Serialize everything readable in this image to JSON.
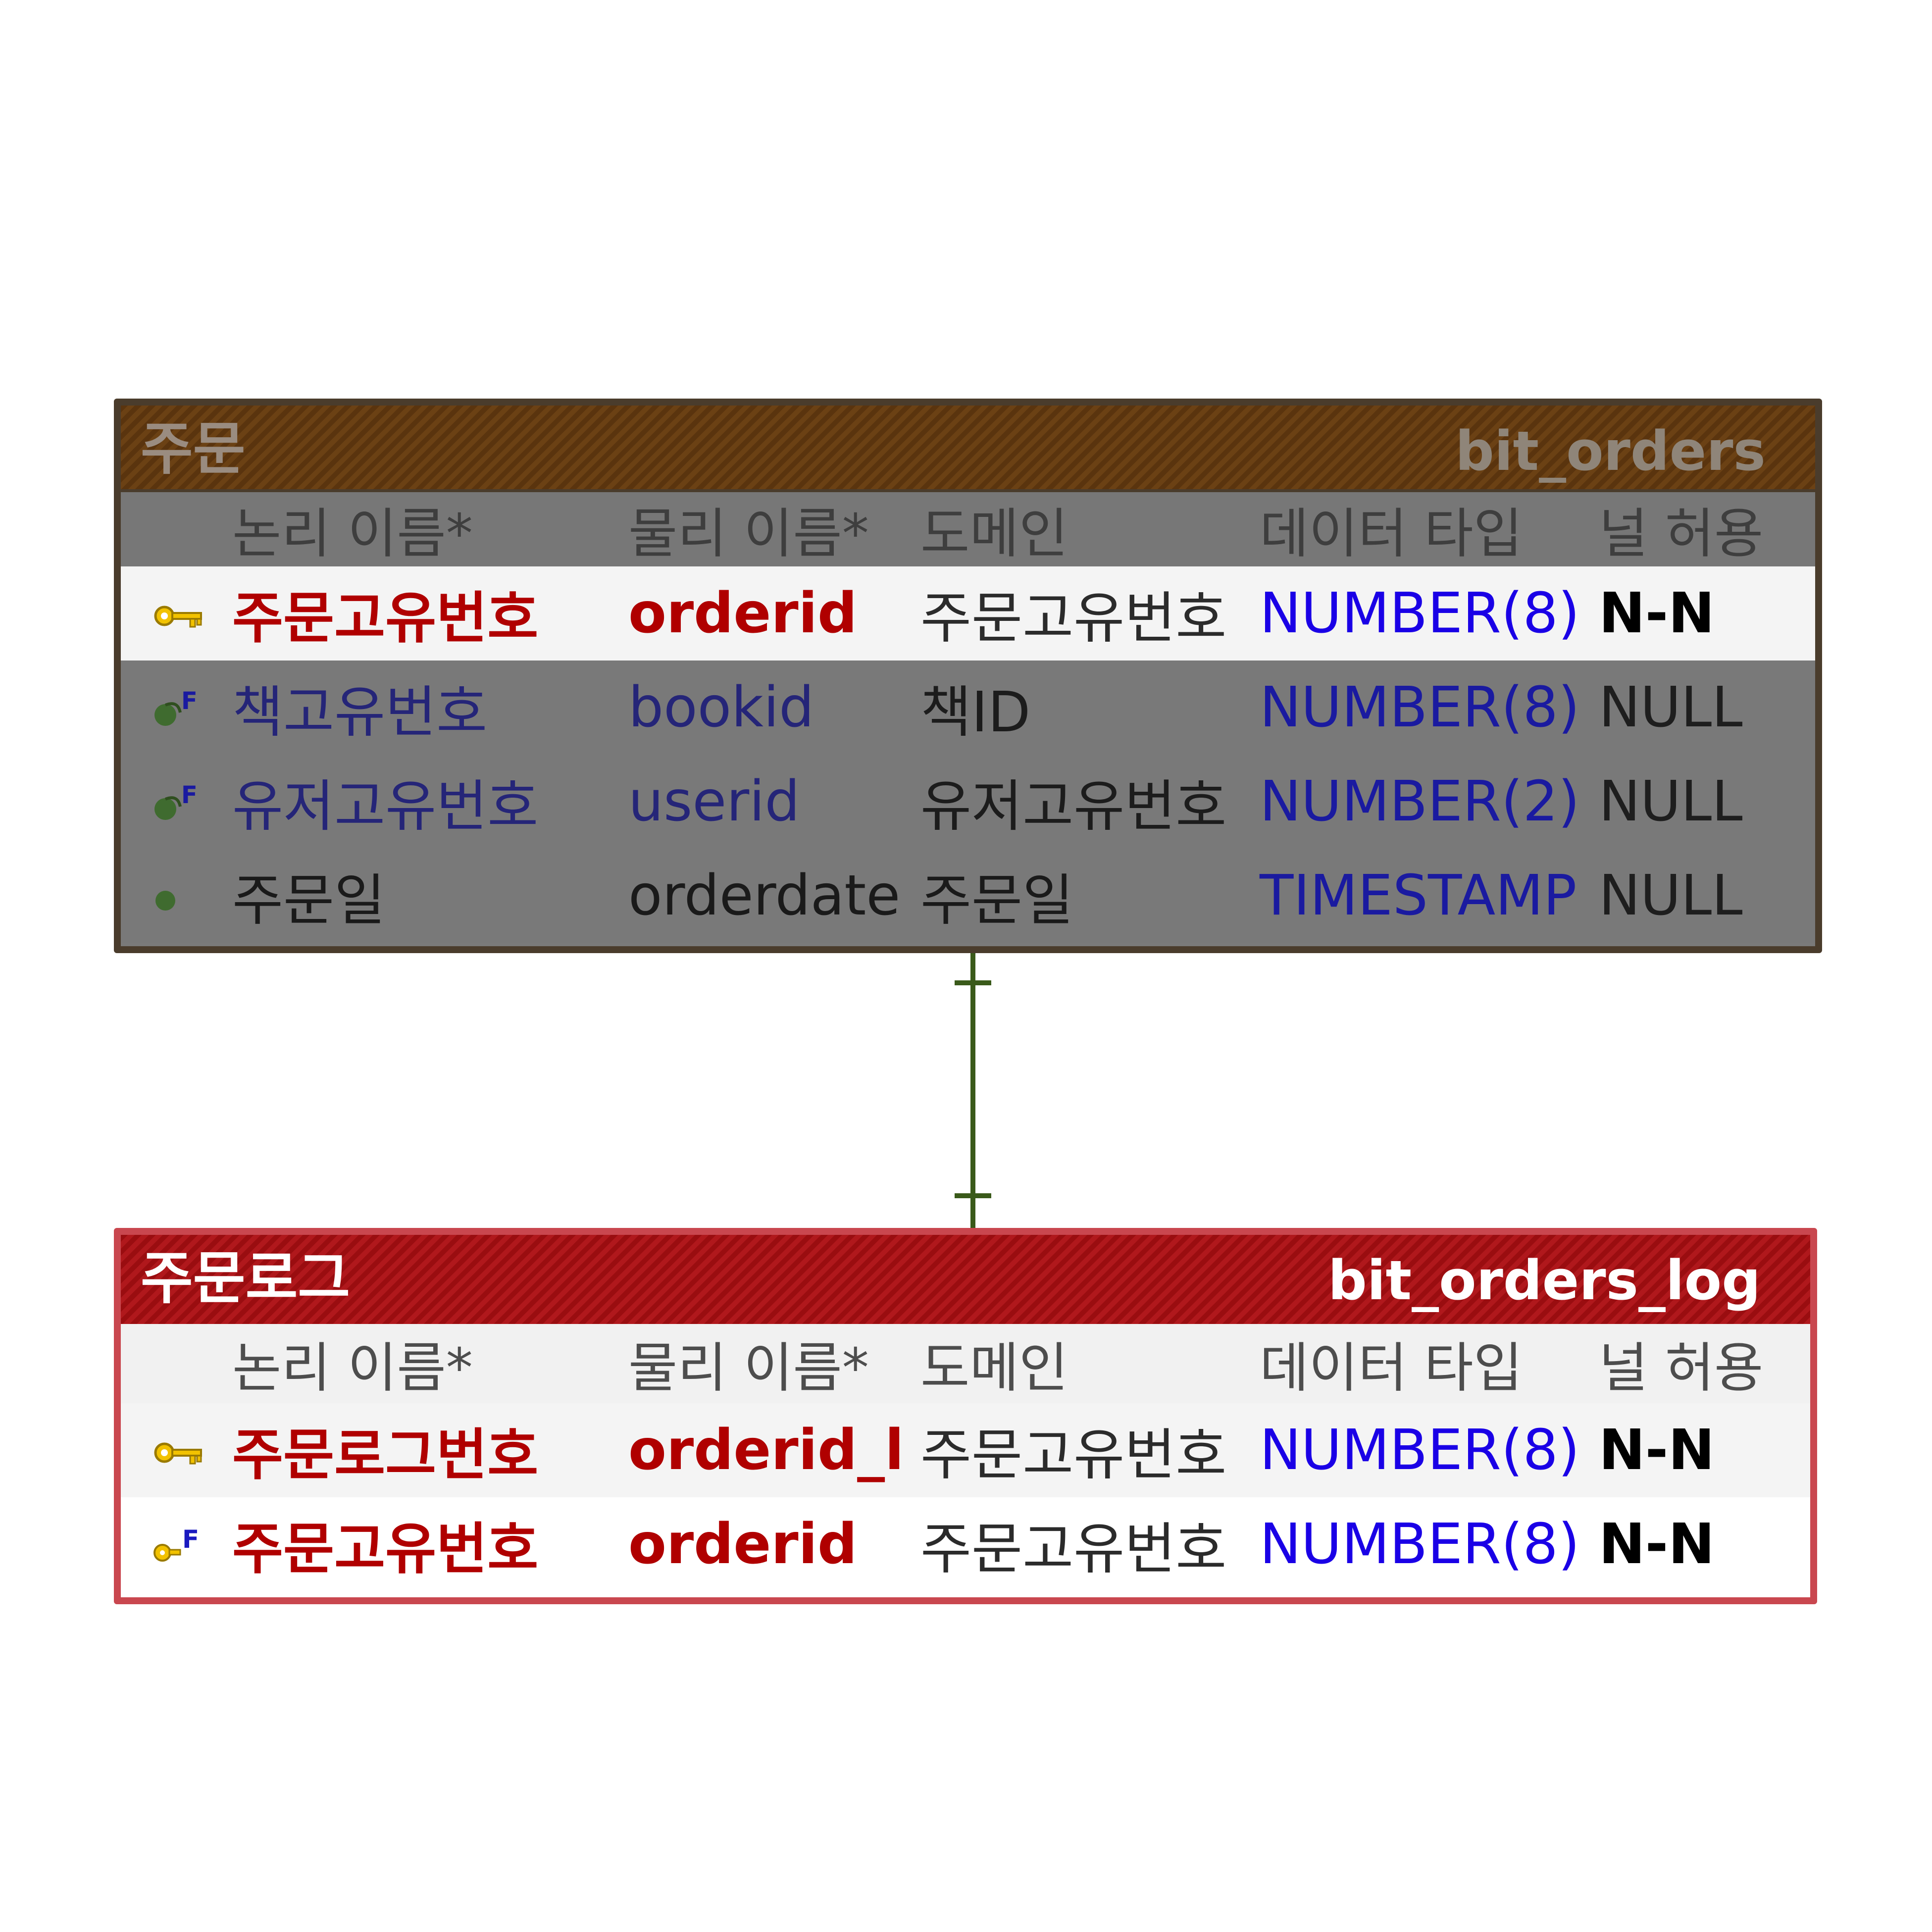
{
  "orders": {
    "logical_name": "주문",
    "physical_name": "bit_orders",
    "headers": {
      "logical": "논리 이름*",
      "physical": "물리 이름*",
      "domain": "도메인",
      "type": "데이터 타입",
      "null": "널 허용"
    },
    "rows": [
      {
        "key": "PK",
        "icon": "primary-key-icon",
        "logical": "주문고유번호",
        "physical": "orderid",
        "domain": "주문고유번호",
        "type": "NUMBER(8)",
        "null": "N-N"
      },
      {
        "key": "FK",
        "icon": "foreign-key-icon",
        "logical": "책고유번호",
        "physical": "bookid",
        "domain": "책ID",
        "type": "NUMBER(8)",
        "null": "NULL"
      },
      {
        "key": "FK",
        "icon": "foreign-key-icon",
        "logical": "유저고유번호",
        "physical": "userid",
        "domain": "유저고유번호",
        "type": "NUMBER(2)",
        "null": "NULL"
      },
      {
        "key": "",
        "icon": "attribute-icon",
        "logical": "주문일",
        "physical": "orderdate",
        "domain": "주문일",
        "type": "TIMESTAMP",
        "null": "NULL"
      }
    ]
  },
  "orders_log": {
    "logical_name": "주문로그",
    "physical_name": "bit_orders_log",
    "headers": {
      "logical": "논리 이름*",
      "physical": "물리 이름*",
      "domain": "도메인",
      "type": "데이터 타입",
      "null": "널 허용"
    },
    "rows": [
      {
        "key": "PK",
        "icon": "primary-key-icon",
        "logical": "주문로그번호",
        "physical": "orderid_l",
        "domain": "주문고유번호",
        "type": "NUMBER(8)",
        "null": "N-N"
      },
      {
        "key": "PFK",
        "icon": "primary-foreign-key-icon",
        "logical": "주문고유번호",
        "physical": "orderid",
        "domain": "주문고유번호",
        "type": "NUMBER(8)",
        "null": "N-N"
      }
    ]
  },
  "colors": {
    "orders_header": "#5a340e",
    "orders_log_header": "#9a0d10",
    "pk_text": "#b00000",
    "type_text": "#1a00e6",
    "relationship": "#3a5a1a"
  }
}
